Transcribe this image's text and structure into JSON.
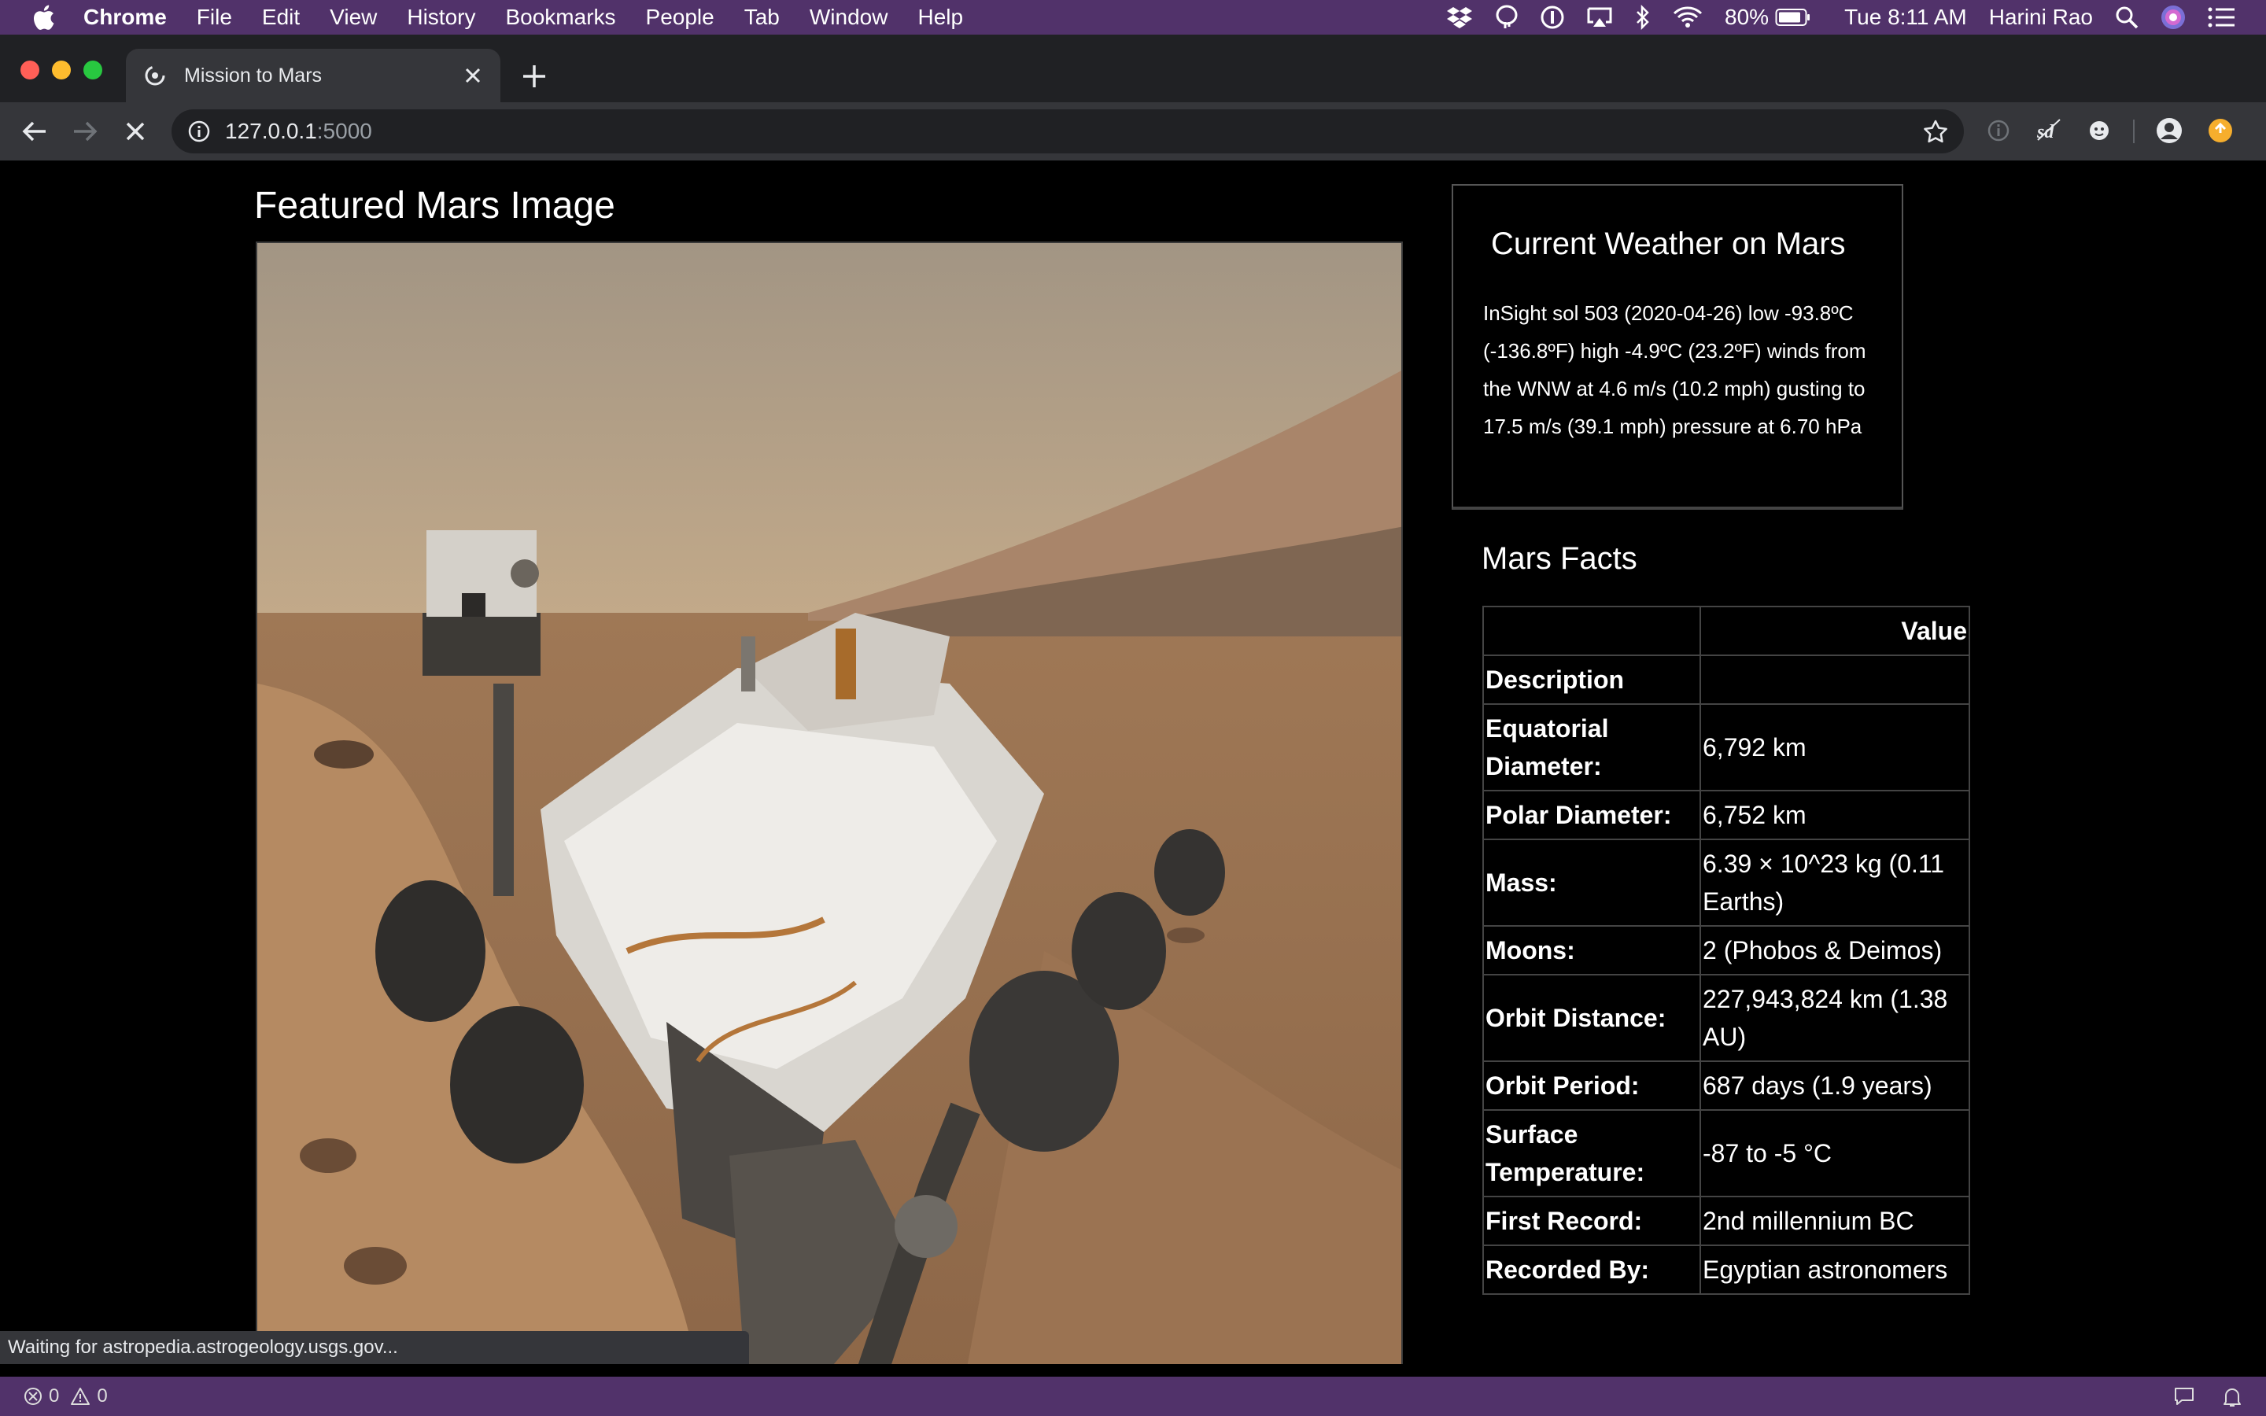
{
  "menubar": {
    "apple": "apple-icon",
    "app_name": "Chrome",
    "items": [
      "File",
      "Edit",
      "View",
      "History",
      "Bookmarks",
      "People",
      "Tab",
      "Window",
      "Help"
    ],
    "battery": "80%",
    "clock": "Tue 8:11 AM",
    "user": "Harini Rao"
  },
  "browser": {
    "tab_title": "Mission to Mars",
    "url_host": "127.0.0.1",
    "url_port": ":5000",
    "status_text": "Waiting for astropedia.astrogeology.usgs.gov..."
  },
  "page": {
    "featured_title": "Featured Mars Image",
    "weather": {
      "title": "Current Weather on Mars",
      "text": "InSight sol 503 (2020-04-26) low -93.8ºC (-136.8ºF) high -4.9ºC (23.2ºF) winds from the WNW at 4.6 m/s (10.2 mph) gusting to 17.5 m/s (39.1 mph) pressure at 6.70 hPa"
    },
    "facts": {
      "title": "Mars Facts",
      "header_value": "Value",
      "header_index": "Description",
      "rows": [
        {
          "label": "Equatorial Diameter:",
          "value": "6,792 km"
        },
        {
          "label": "Polar Diameter:",
          "value": "6,752 km"
        },
        {
          "label": "Mass:",
          "value": "6.39 × 10^23 kg (0.11 Earths)"
        },
        {
          "label": "Moons:",
          "value": "2 (Phobos & Deimos)"
        },
        {
          "label": "Orbit Distance:",
          "value": "227,943,824 km (1.38 AU)"
        },
        {
          "label": "Orbit Period:",
          "value": "687 days (1.9 years)"
        },
        {
          "label": "Surface Temperature:",
          "value": "-87 to -5 °C"
        },
        {
          "label": "First Record:",
          "value": "2nd millennium BC"
        },
        {
          "label": "Recorded By:",
          "value": "Egyptian astronomers"
        }
      ]
    }
  },
  "bottombar": {
    "errors": "0",
    "warnings": "0"
  },
  "colors": {
    "menubar": "#51326a",
    "tabstrip": "#202124",
    "toolbar": "#35363a",
    "page_bg": "#000000"
  }
}
